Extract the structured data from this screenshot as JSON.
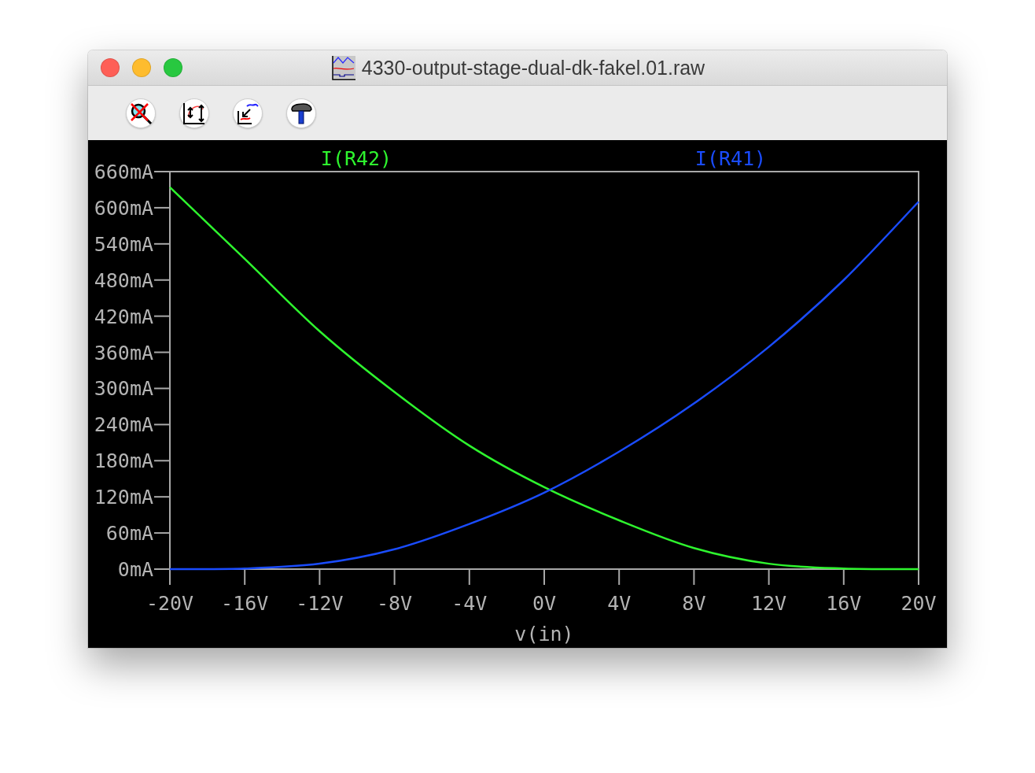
{
  "window": {
    "title": "4330-output-stage-dual-dk-fakel.01.raw"
  },
  "plot": {
    "chart_data": {
      "type": "line",
      "xlabel": "v(in)",
      "x": [
        -20,
        -16,
        -12,
        -8,
        -4,
        0,
        4,
        8,
        12,
        16,
        20
      ],
      "series": [
        {
          "name": "I(R42)",
          "color": "#2ef52e",
          "values": [
            634,
            515,
            395,
            294,
            205,
            136,
            81,
            35,
            9,
            1,
            0
          ]
        },
        {
          "name": "I(R41)",
          "color": "#1a4cff",
          "values": [
            0,
            1,
            9,
            33,
            75,
            127,
            195,
            275,
            369,
            480,
            610
          ]
        }
      ],
      "xlim": [
        -20,
        20
      ],
      "ylim": [
        0,
        660
      ],
      "xticks": [
        {
          "value": -20,
          "label": "-20V"
        },
        {
          "value": -16,
          "label": "-16V"
        },
        {
          "value": -12,
          "label": "-12V"
        },
        {
          "value": -8,
          "label": "-8V"
        },
        {
          "value": -4,
          "label": "-4V"
        },
        {
          "value": 0,
          "label": "0V"
        },
        {
          "value": 4,
          "label": "4V"
        },
        {
          "value": 8,
          "label": "8V"
        },
        {
          "value": 12,
          "label": "12V"
        },
        {
          "value": 16,
          "label": "16V"
        },
        {
          "value": 20,
          "label": "20V"
        }
      ],
      "yticks": [
        {
          "value": 0,
          "label": "0mA"
        },
        {
          "value": 60,
          "label": "60mA"
        },
        {
          "value": 120,
          "label": "120mA"
        },
        {
          "value": 180,
          "label": "180mA"
        },
        {
          "value": 240,
          "label": "240mA"
        },
        {
          "value": 300,
          "label": "300mA"
        },
        {
          "value": 360,
          "label": "360mA"
        },
        {
          "value": 420,
          "label": "420mA"
        },
        {
          "value": 480,
          "label": "480mA"
        },
        {
          "value": 540,
          "label": "540mA"
        },
        {
          "value": 600,
          "label": "600mA"
        },
        {
          "value": 660,
          "label": "660mA"
        }
      ]
    }
  }
}
